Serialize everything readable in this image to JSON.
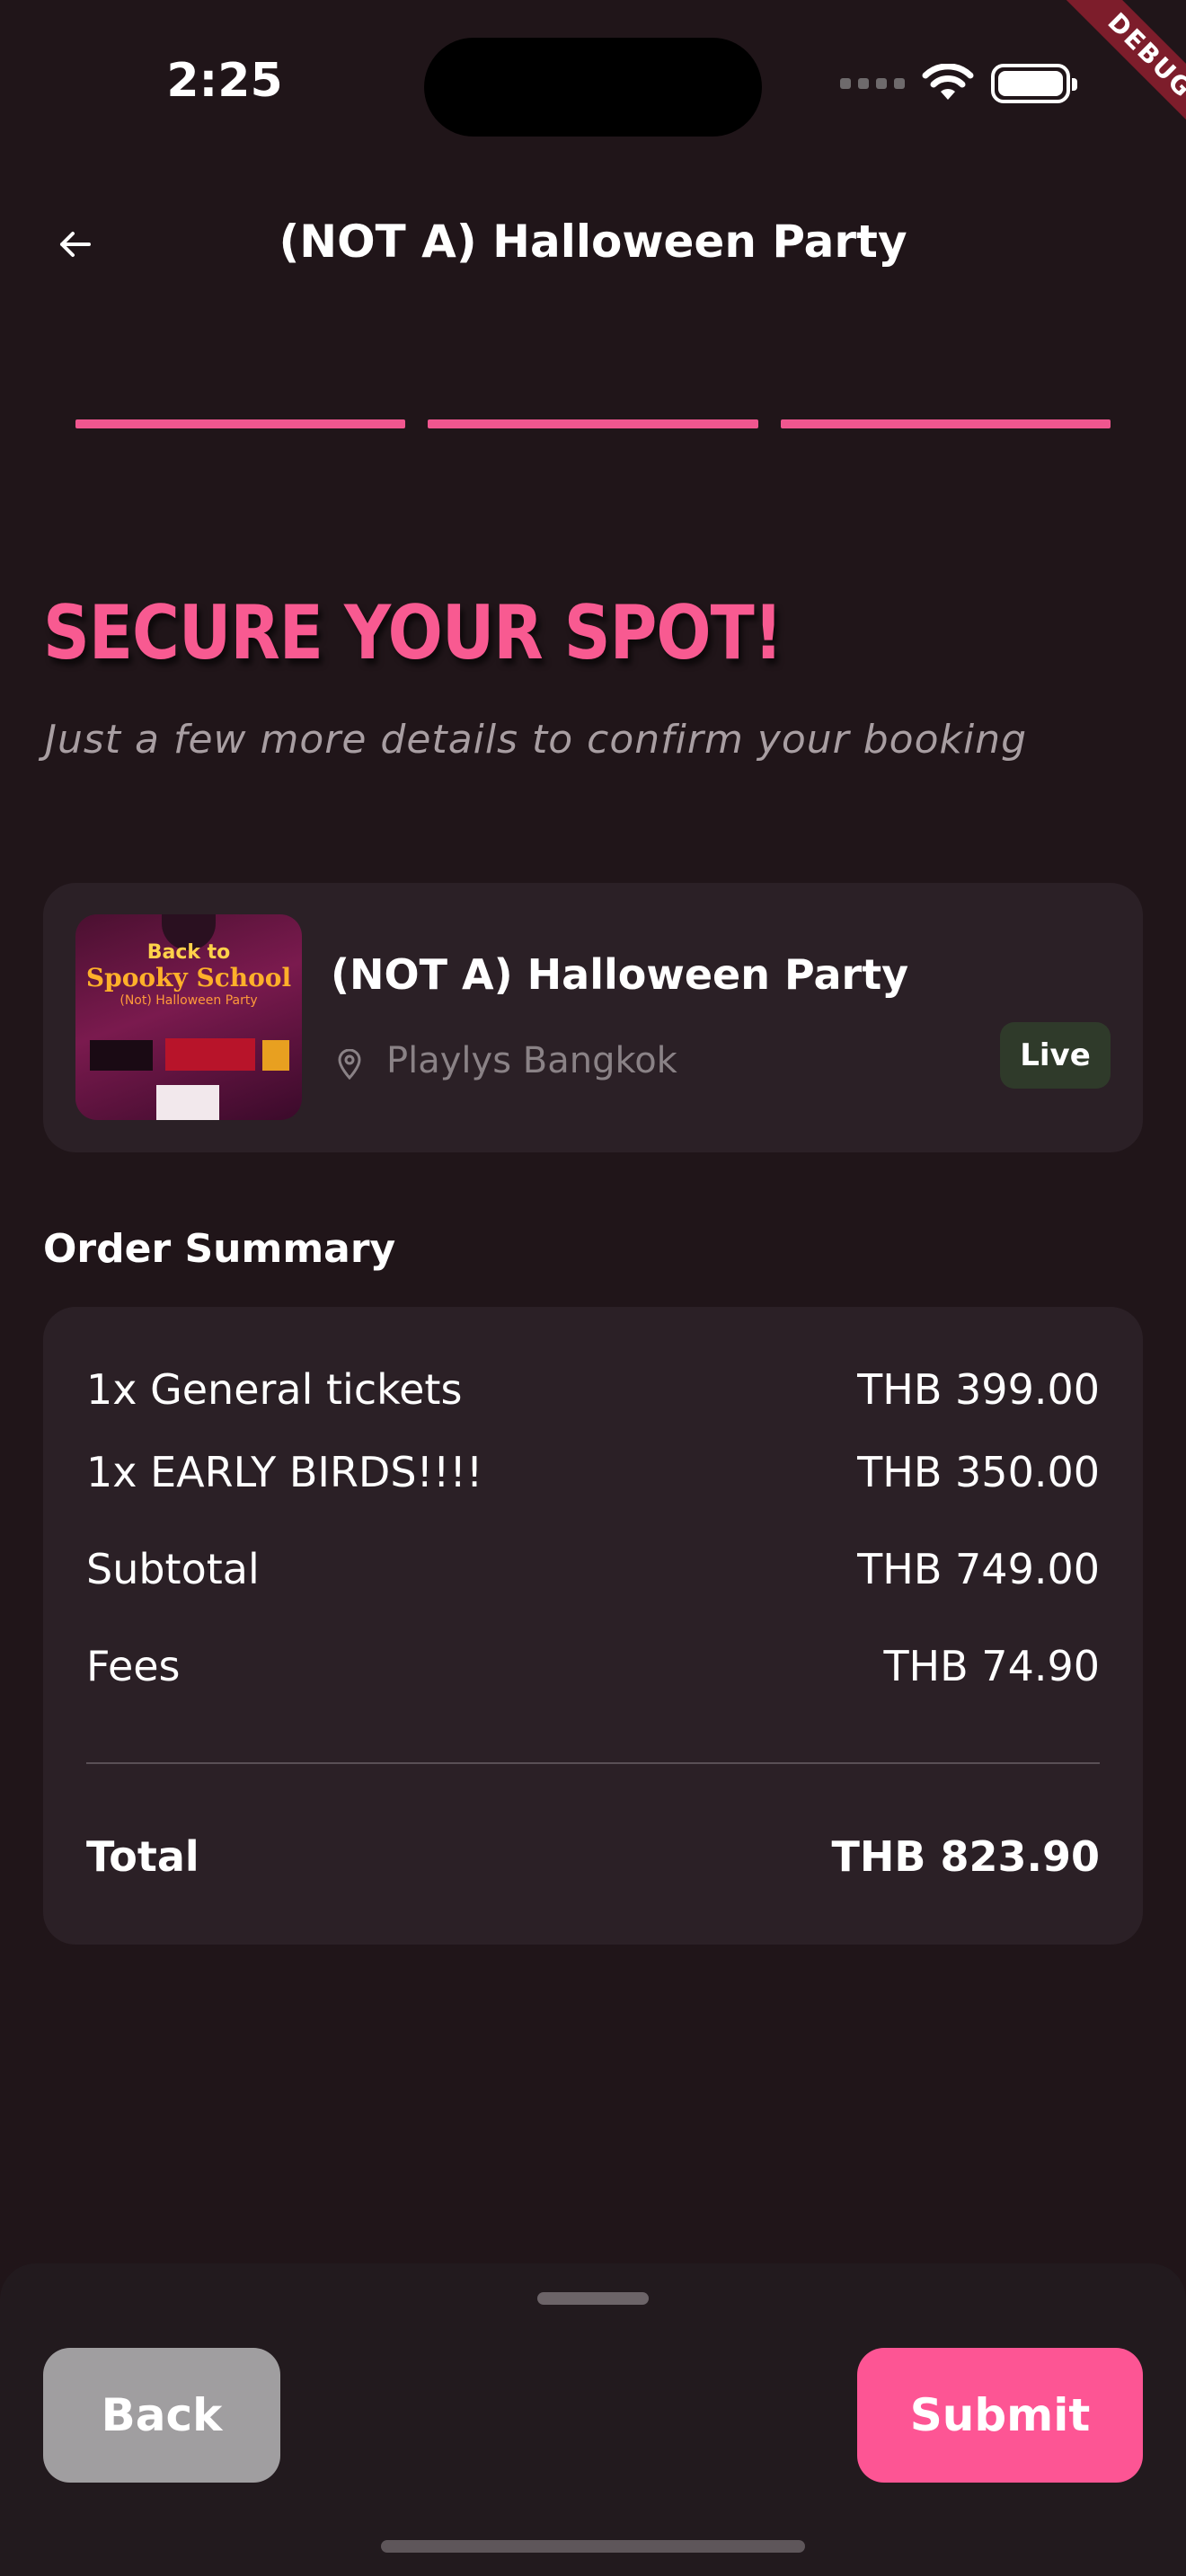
{
  "status_bar": {
    "time": "2:25"
  },
  "debug_ribbon": "DEBUG",
  "header": {
    "title": "(NOT A) Halloween Party"
  },
  "progress": {
    "steps_total": 3,
    "steps_completed": 3
  },
  "heading": {
    "title": "SECURE YOUR SPOT!",
    "subtitle": "Just a few more details to confirm your booking"
  },
  "event": {
    "title": "(NOT A) Halloween Party",
    "venue": "Playlys Bangkok",
    "status": "Live",
    "poster": {
      "line1": "Back to",
      "line2": "Spooky School",
      "line3": "(Not) Halloween Party"
    }
  },
  "order_summary": {
    "heading": "Order Summary",
    "items": [
      {
        "label": "1x General tickets",
        "value": "THB 399.00"
      },
      {
        "label": "1x EARLY BIRDS!!!!",
        "value": "THB 350.00"
      }
    ],
    "subtotal": {
      "label": "Subtotal",
      "value": "THB 749.00"
    },
    "fees": {
      "label": "Fees",
      "value": "THB 74.90"
    },
    "total": {
      "label": "Total",
      "value": "THB 823.90"
    }
  },
  "actions": {
    "back": "Back",
    "submit": "Submit"
  },
  "colors": {
    "accent": "#fd5594",
    "background": "#201519",
    "card": "#2b2026"
  }
}
